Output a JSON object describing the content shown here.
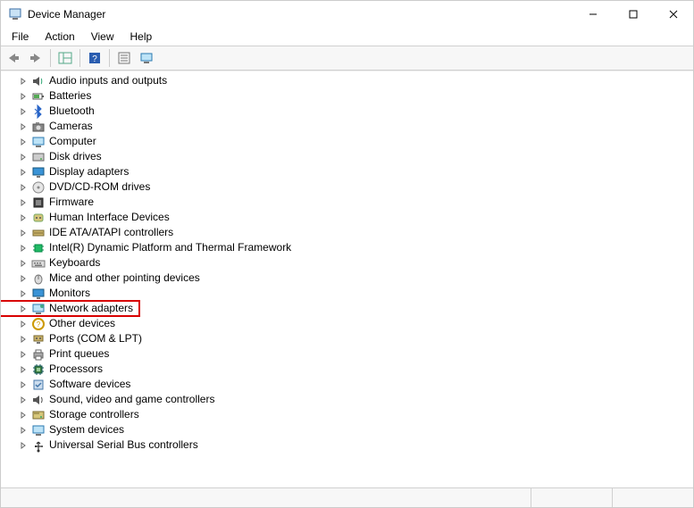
{
  "window": {
    "title": "Device Manager"
  },
  "menu": {
    "file": "File",
    "action": "Action",
    "view": "View",
    "help": "Help"
  },
  "highlight": {
    "target_index": 16
  },
  "tree": [
    {
      "label": "Audio inputs and outputs",
      "icon": "speaker-icon"
    },
    {
      "label": "Batteries",
      "icon": "battery-icon"
    },
    {
      "label": "Bluetooth",
      "icon": "bluetooth-icon"
    },
    {
      "label": "Cameras",
      "icon": "camera-icon"
    },
    {
      "label": "Computer",
      "icon": "computer-icon"
    },
    {
      "label": "Disk drives",
      "icon": "disk-icon"
    },
    {
      "label": "Display adapters",
      "icon": "display-icon"
    },
    {
      "label": "DVD/CD-ROM drives",
      "icon": "cdrom-icon"
    },
    {
      "label": "Firmware",
      "icon": "firmware-icon"
    },
    {
      "label": "Human Interface Devices",
      "icon": "hid-icon"
    },
    {
      "label": "IDE ATA/ATAPI controllers",
      "icon": "ide-icon"
    },
    {
      "label": "Intel(R) Dynamic Platform and Thermal Framework",
      "icon": "chip-icon"
    },
    {
      "label": "Keyboards",
      "icon": "keyboard-icon"
    },
    {
      "label": "Mice and other pointing devices",
      "icon": "mouse-icon"
    },
    {
      "label": "Monitors",
      "icon": "monitor-icon"
    },
    {
      "label": "Network adapters",
      "icon": "network-icon"
    },
    {
      "label": "Other devices",
      "icon": "other-icon"
    },
    {
      "label": "Ports (COM & LPT)",
      "icon": "port-icon"
    },
    {
      "label": "Print queues",
      "icon": "printer-icon"
    },
    {
      "label": "Processors",
      "icon": "cpu-icon"
    },
    {
      "label": "Software devices",
      "icon": "software-icon"
    },
    {
      "label": "Sound, video and game controllers",
      "icon": "sound-icon"
    },
    {
      "label": "Storage controllers",
      "icon": "storage-icon"
    },
    {
      "label": "System devices",
      "icon": "system-icon"
    },
    {
      "label": "Universal Serial Bus controllers",
      "icon": "usb-icon"
    }
  ]
}
